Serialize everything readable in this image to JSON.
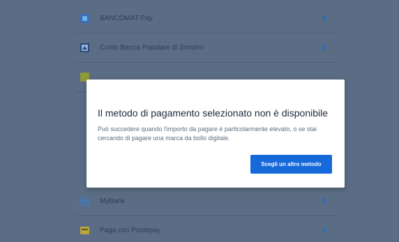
{
  "payment_methods": [
    {
      "label": "BANCOMAT Pay",
      "icon": "bancomat-pay-icon"
    },
    {
      "label": "Conto Banca Popolare di Sondrio",
      "icon": "bank-icon"
    },
    {
      "label": "",
      "icon": "wallet-icon"
    },
    {
      "label": "MyBank",
      "icon": "mybank-icon"
    },
    {
      "label": "Paga con Postepay",
      "icon": "postepay-icon"
    }
  ],
  "modal": {
    "title": "Il metodo di pagamento selezionato non è disponibile",
    "body": "Può succedere quando l'importo da pagare è particolarmente elevato, o se stai cercando di pagare una marca da bollo digitale.",
    "button_label": "Scegli un altro metodo"
  },
  "colors": {
    "overlay_background": "#5b6d84",
    "primary_button": "#1669d8",
    "chevron": "#1669d8"
  }
}
